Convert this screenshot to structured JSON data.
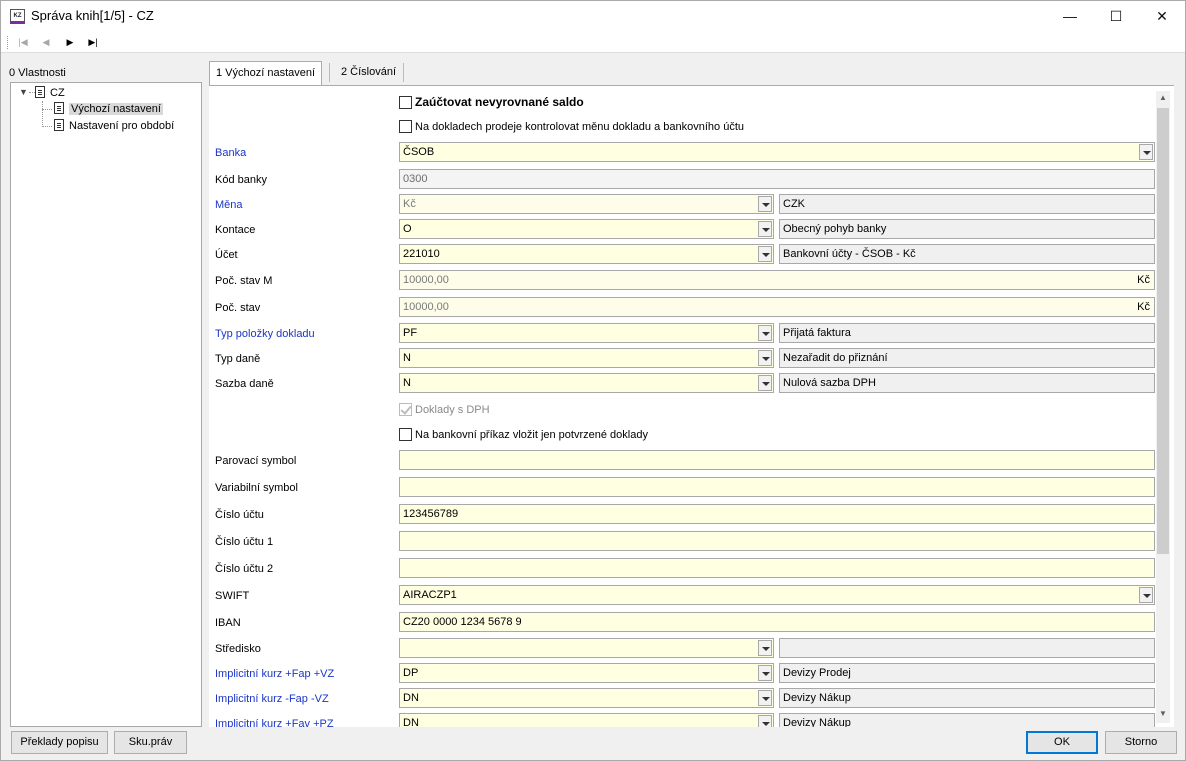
{
  "window": {
    "title": "Správa knih[1/5] - CZ",
    "app_icon_text": "KZ",
    "controls": {
      "minimize": "—",
      "maximize": "☐",
      "close": "✕"
    }
  },
  "toolbar": {
    "first": "|◀",
    "prev": "◀",
    "next": "▶",
    "last": "▶|"
  },
  "left_panel": {
    "label": "0 Vlastnosti",
    "tree": {
      "root": "CZ",
      "children": [
        "Výchozí nastavení",
        "Nastavení pro období"
      ],
      "selected": "Výchozí nastavení"
    }
  },
  "tabs": [
    {
      "label": "1 Výchozí nastavení",
      "active": true
    },
    {
      "label": "2 Číslování",
      "active": false
    }
  ],
  "form": {
    "check_saldo": {
      "label": "Zaúčtovat nevyrovnané saldo",
      "checked": false
    },
    "check_mena": {
      "label": "Na dokladech prodeje kontrolovat měnu dokladu a bankovního účtu",
      "checked": false
    },
    "banka": {
      "label": "Banka",
      "value": "ČSOB"
    },
    "kod_banky": {
      "label": "Kód banky",
      "value": "0300"
    },
    "mena": {
      "label": "Měna",
      "value": "Kč",
      "desc": "CZK"
    },
    "kontace": {
      "label": "Kontace",
      "value": "O",
      "desc": "Obecný pohyb banky"
    },
    "ucet": {
      "label": "Účet",
      "value": "221010",
      "desc": "Bankovní účty - ČSOB - Kč"
    },
    "poc_stav_m": {
      "label": "Poč. stav M",
      "value": "10000,00",
      "suffix": "Kč"
    },
    "poc_stav": {
      "label": "Poč. stav",
      "value": "10000,00",
      "suffix": "Kč"
    },
    "typ_polozky": {
      "label": "Typ položky dokladu",
      "value": "PF",
      "desc": "Přijatá faktura"
    },
    "typ_dane": {
      "label": "Typ daně",
      "value": "N",
      "desc": "Nezařadit do přiznání"
    },
    "sazba_dane": {
      "label": "Sazba daně",
      "value": "N",
      "desc": "Nulová sazba DPH"
    },
    "check_dph": {
      "label": "Doklady s DPH",
      "checked": true
    },
    "check_prikaz": {
      "label": "Na bankovní příkaz vložit jen potvrzené doklady",
      "checked": false
    },
    "parovaci": {
      "label": "Parovací symbol",
      "value": ""
    },
    "variabilni": {
      "label": "Variabilní symbol",
      "value": ""
    },
    "cislo_uctu": {
      "label": "Číslo účtu",
      "value": "123456789"
    },
    "cislo_uctu_1": {
      "label": "Číslo účtu 1",
      "value": ""
    },
    "cislo_uctu_2": {
      "label": "Číslo účtu 2",
      "value": ""
    },
    "swift": {
      "label": "SWIFT",
      "value": "AIRACZP1"
    },
    "iban": {
      "label": "IBAN",
      "value": "CZ20 0000 1234 5678 9"
    },
    "stredisko": {
      "label": "Středisko",
      "value": "",
      "desc": ""
    },
    "kurz_fap": {
      "label": "Implicitní kurz +Fap +VZ",
      "value": "DP",
      "desc": "Devizy Prodej"
    },
    "kurz_fap_minus": {
      "label": "Implicitní kurz -Fap -VZ",
      "value": "DN",
      "desc": "Devizy Nákup"
    },
    "kurz_fav": {
      "label": "Implicitní kurz +Fav +PZ",
      "value": "DN",
      "desc": "Devizy Nákup"
    }
  },
  "buttons": {
    "preklady": "Překlady popisu",
    "sku": "Sku.práv",
    "ok": "OK",
    "storno": "Storno"
  },
  "scroll": {
    "up": "▲",
    "down": "▼"
  }
}
